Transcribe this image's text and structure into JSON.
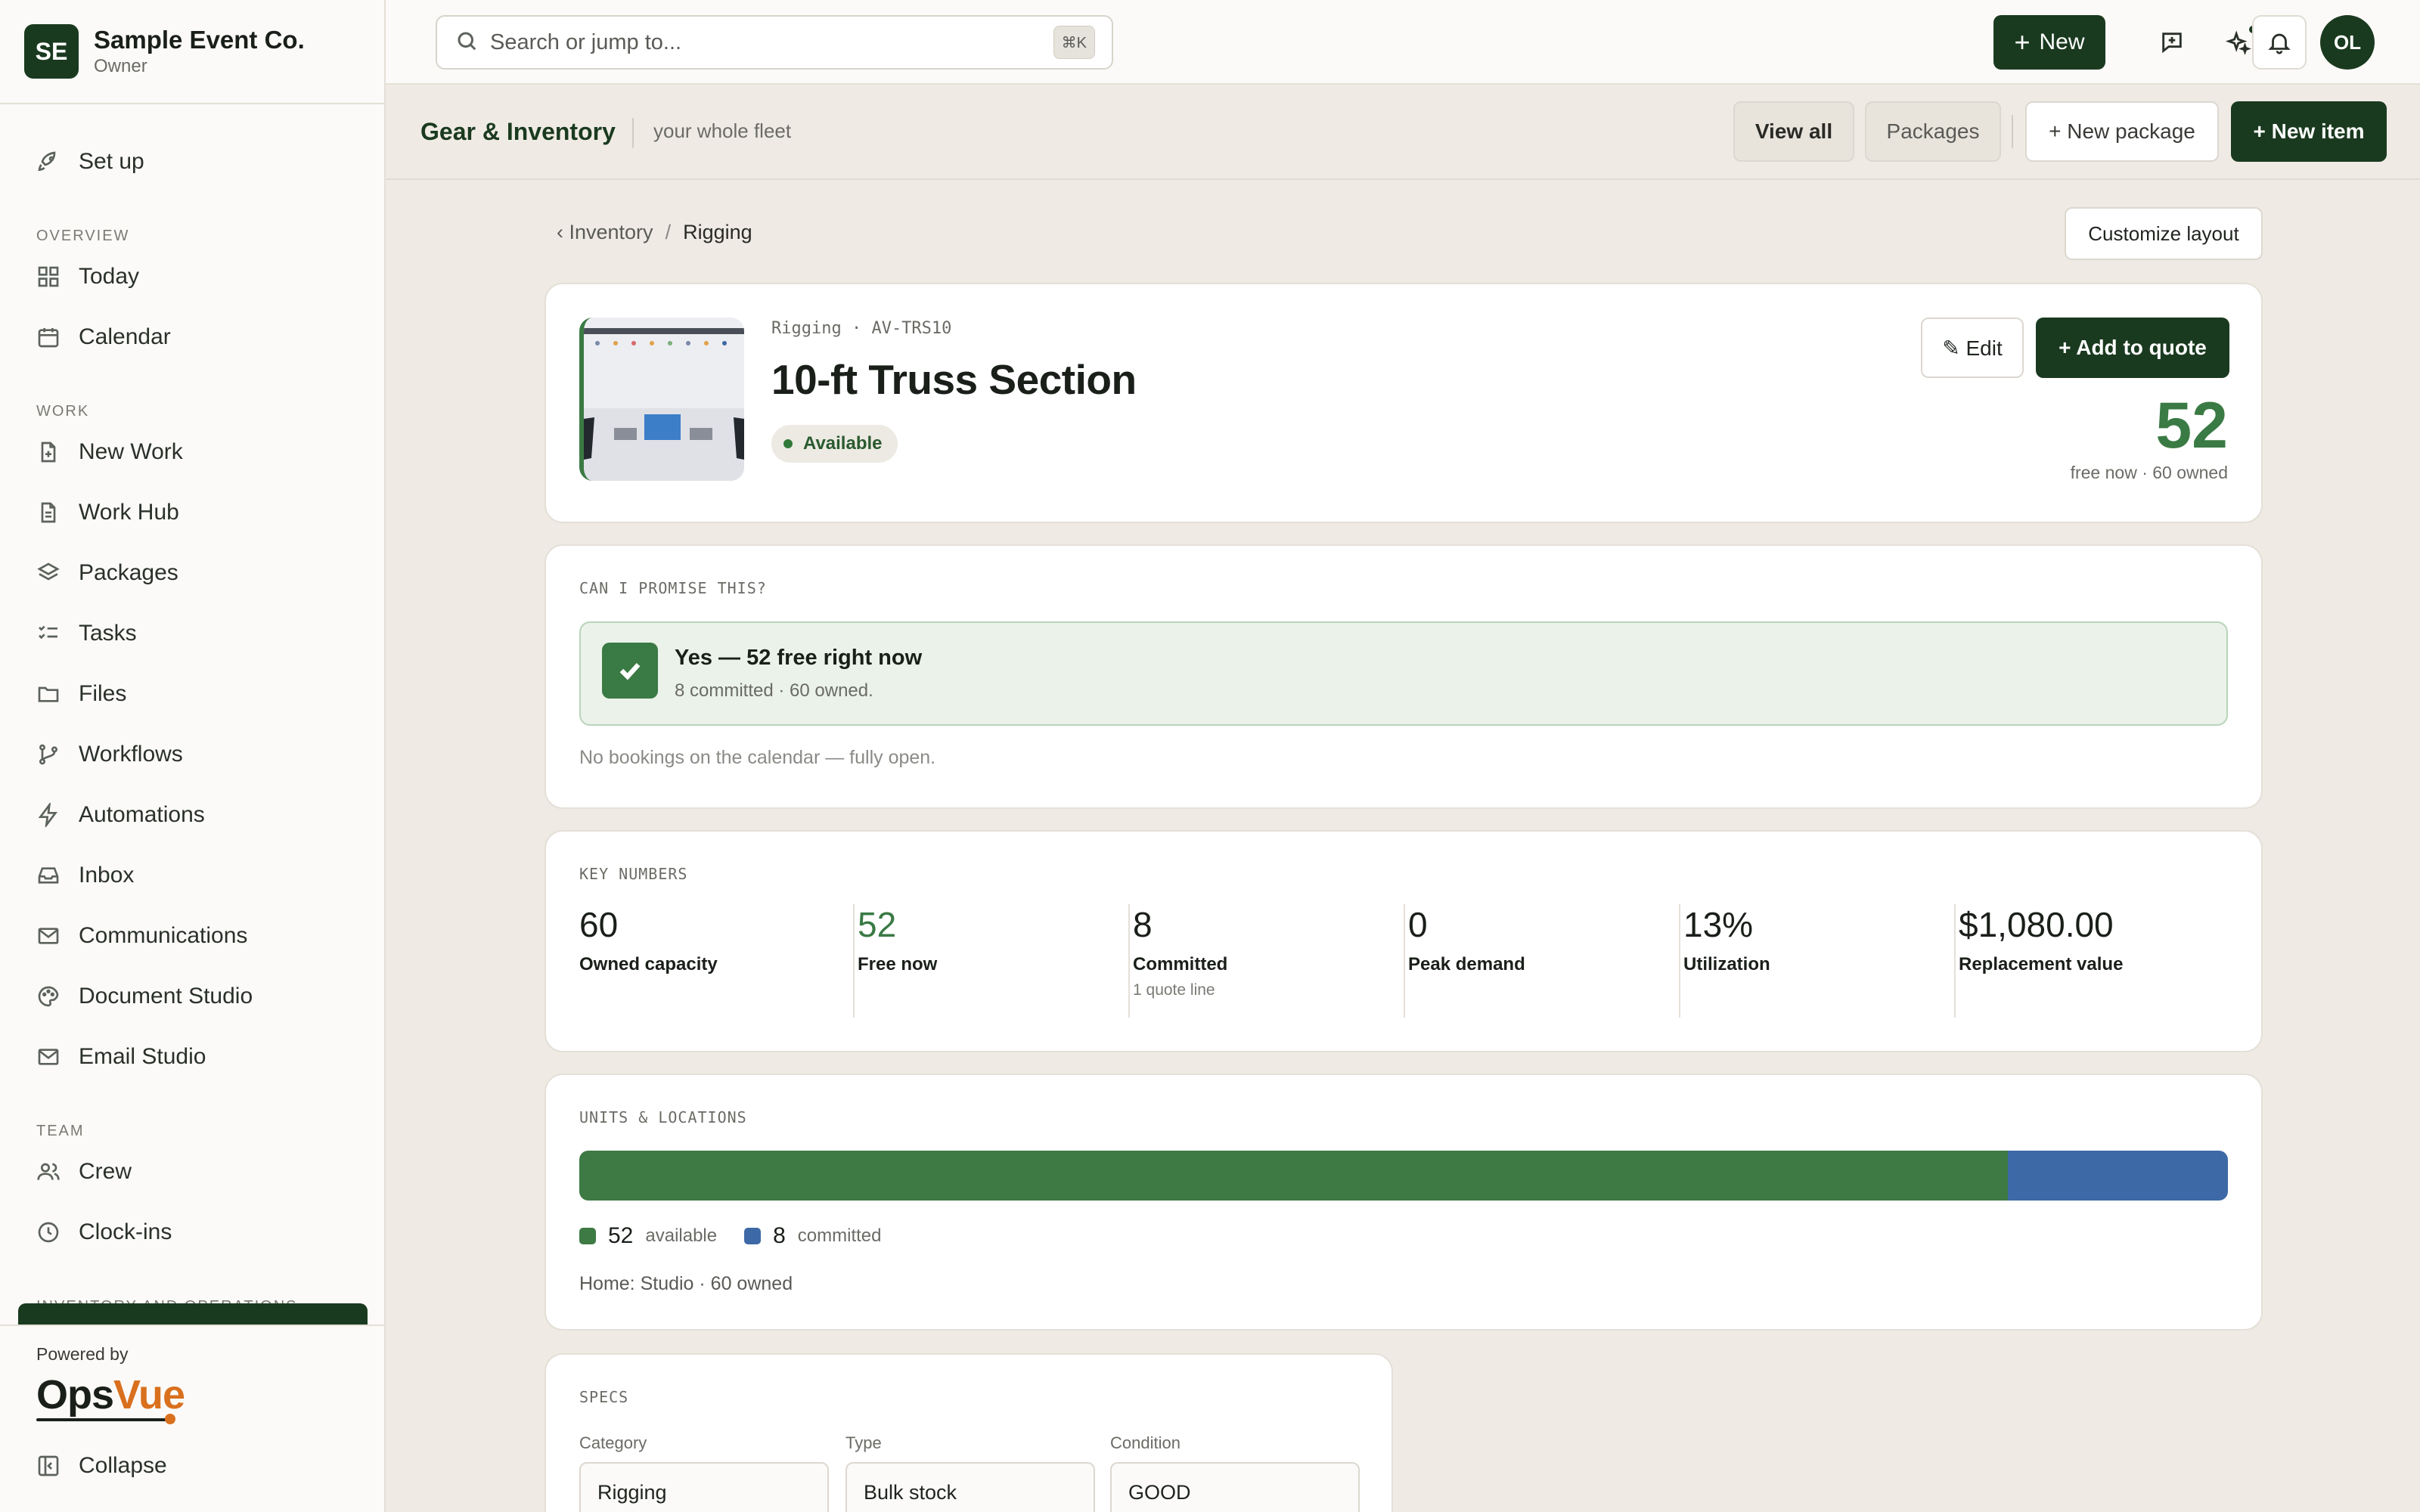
{
  "org": {
    "initials": "SE",
    "name": "Sample Event Co.",
    "role": "Owner"
  },
  "sidebar": {
    "setup": "Set up",
    "sections": {
      "overview": "OVERVIEW",
      "work": "WORK",
      "team": "TEAM",
      "inventory": "INVENTORY AND OPERATIONS"
    },
    "items": {
      "today": "Today",
      "calendar": "Calendar",
      "new_work": "New Work",
      "work_hub": "Work Hub",
      "packages": "Packages",
      "tasks": "Tasks",
      "files": "Files",
      "workflows": "Workflows",
      "automations": "Automations",
      "inbox": "Inbox",
      "communications": "Communications",
      "document_studio": "Document Studio",
      "email_studio": "Email Studio",
      "crew": "Crew",
      "clock_ins": "Clock-ins"
    },
    "powered_by": "Powered by",
    "brand_ops": "Ops",
    "brand_vue": "Vue",
    "collapse": "Collapse"
  },
  "topbar": {
    "search_placeholder": "Search or jump to...",
    "shortcut": "⌘K",
    "new_label": "New",
    "user_initials": "OL"
  },
  "subheader": {
    "title": "Gear & Inventory",
    "description": "your whole fleet",
    "view_all": "View all",
    "packages": "Packages",
    "new_package": "+ New package",
    "new_item": "+ New item"
  },
  "breadcrumb": {
    "parent": "‹ Inventory",
    "separator": "/",
    "current": "Rigging"
  },
  "customize_layout": "Customize layout",
  "item": {
    "meta": "Rigging · AV-TRS10",
    "title": "10-ft Truss Section",
    "status": "Available",
    "edit_label": "✎ Edit",
    "add_to_quote": "+ Add to quote",
    "free_now": "52",
    "free_sub": "free now · 60 owned"
  },
  "promise": {
    "label": "CAN I PROMISE THIS?",
    "title": "Yes — 52 free right now",
    "subtitle": "8 committed · 60 owned.",
    "note": "No bookings on the calendar — fully open."
  },
  "key_numbers": {
    "label": "KEY NUMBERS",
    "items": [
      {
        "value": "60",
        "label": "Owned capacity",
        "sub": ""
      },
      {
        "value": "52",
        "label": "Free now",
        "sub": ""
      },
      {
        "value": "8",
        "label": "Committed",
        "sub": "1 quote line"
      },
      {
        "value": "0",
        "label": "Peak demand",
        "sub": ""
      },
      {
        "value": "13%",
        "label": "Utilization",
        "sub": ""
      },
      {
        "value": "$1,080.00",
        "label": "Replacement value",
        "sub": ""
      }
    ]
  },
  "units": {
    "label": "UNITS & LOCATIONS",
    "available_count": "52",
    "available_label": "available",
    "committed_count": "8",
    "committed_label": "committed",
    "available_fraction": 0.8667,
    "committed_fraction": 0.1333,
    "available_color": "#3d7a44",
    "committed_color": "#3d69a6",
    "home": "Home: Studio · 60 owned"
  },
  "specs": {
    "label": "SPECS",
    "fields": [
      {
        "label": "Category",
        "value": "Rigging"
      },
      {
        "label": "Type",
        "value": "Bulk stock"
      },
      {
        "label": "Condition",
        "value": "GOOD"
      }
    ]
  }
}
